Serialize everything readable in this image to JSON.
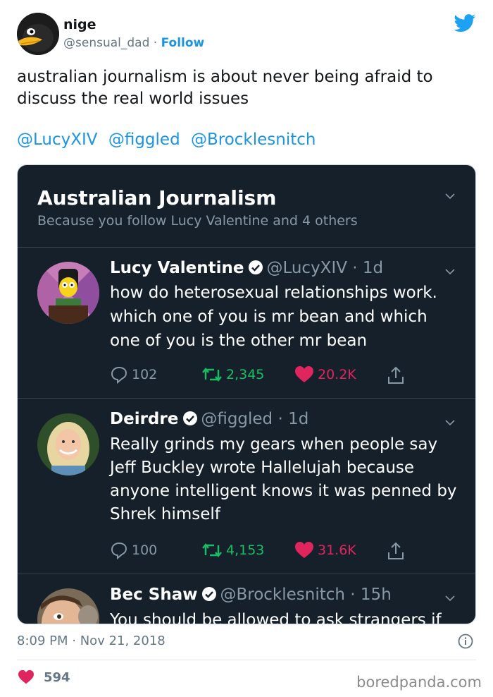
{
  "tweet": {
    "author_name": "nige",
    "author_handle": "@sensual_dad",
    "separator": "·",
    "follow_label": "Follow",
    "text": "australian journalism is about never being afraid to discuss the real world issues",
    "mentions": [
      "@LucyXIV",
      "@figgled",
      "@Brocklesnitch"
    ],
    "time": "8:09 PM",
    "date": "Nov 21, 2018",
    "likes": "594",
    "accent": "#1b95e0"
  },
  "card": {
    "title": "Australian Journalism",
    "subtitle": "Because you follow Lucy Valentine and 4 others",
    "posts": [
      {
        "name": "Lucy Valentine",
        "handle": "@LucyXIV",
        "age": "1d",
        "text": "how do heterosexual relationships work. which one of you is mr bean and which one of you is the other mr bean",
        "replies": "102",
        "retweets": "2,345",
        "likes": "20.2K"
      },
      {
        "name": "Deirdre",
        "handle": "@figgled",
        "age": "1d",
        "text": "Really grinds my gears when people say Jeff Buckley wrote Hallelujah because anyone intelligent knows it was penned by Shrek himself",
        "replies": "100",
        "retweets": "4,153",
        "likes": "31.6K"
      },
      {
        "name": "Bec Shaw",
        "handle": "@Brocklesnitch",
        "age": "15h",
        "text": "You should be allowed to ask strangers if"
      }
    ]
  },
  "watermark": "boredpanda.com",
  "colors": {
    "card_bg": "#15202b",
    "retweet_green": "#17bf63",
    "like_red": "#e0245e",
    "muted": "#8899a6"
  }
}
